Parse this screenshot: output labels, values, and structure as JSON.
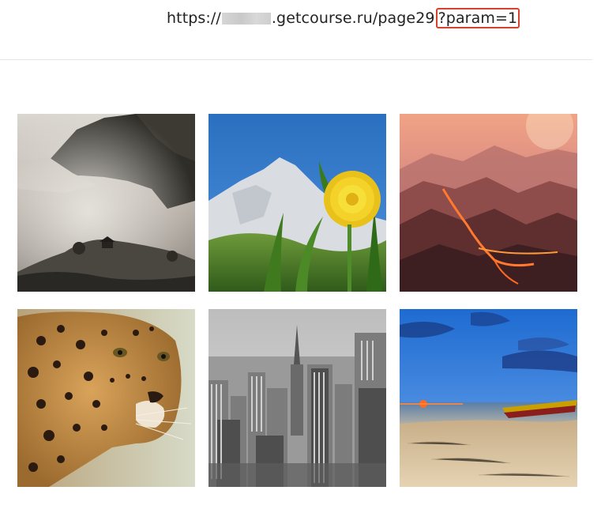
{
  "url": {
    "prefix": "https://",
    "domain_suffix": ".getcourse.ru/page29",
    "query": "?param=1"
  },
  "gallery": {
    "images": [
      {
        "name": "misty-mountain-pagoda-image"
      },
      {
        "name": "dandelion-mountain-image"
      },
      {
        "name": "lava-mountains-image"
      },
      {
        "name": "leopard-image"
      },
      {
        "name": "city-skyline-image"
      },
      {
        "name": "beach-boat-sunset-image"
      }
    ]
  },
  "colors": {
    "highlight": "#d9412c",
    "divider": "#e6e6e6"
  }
}
